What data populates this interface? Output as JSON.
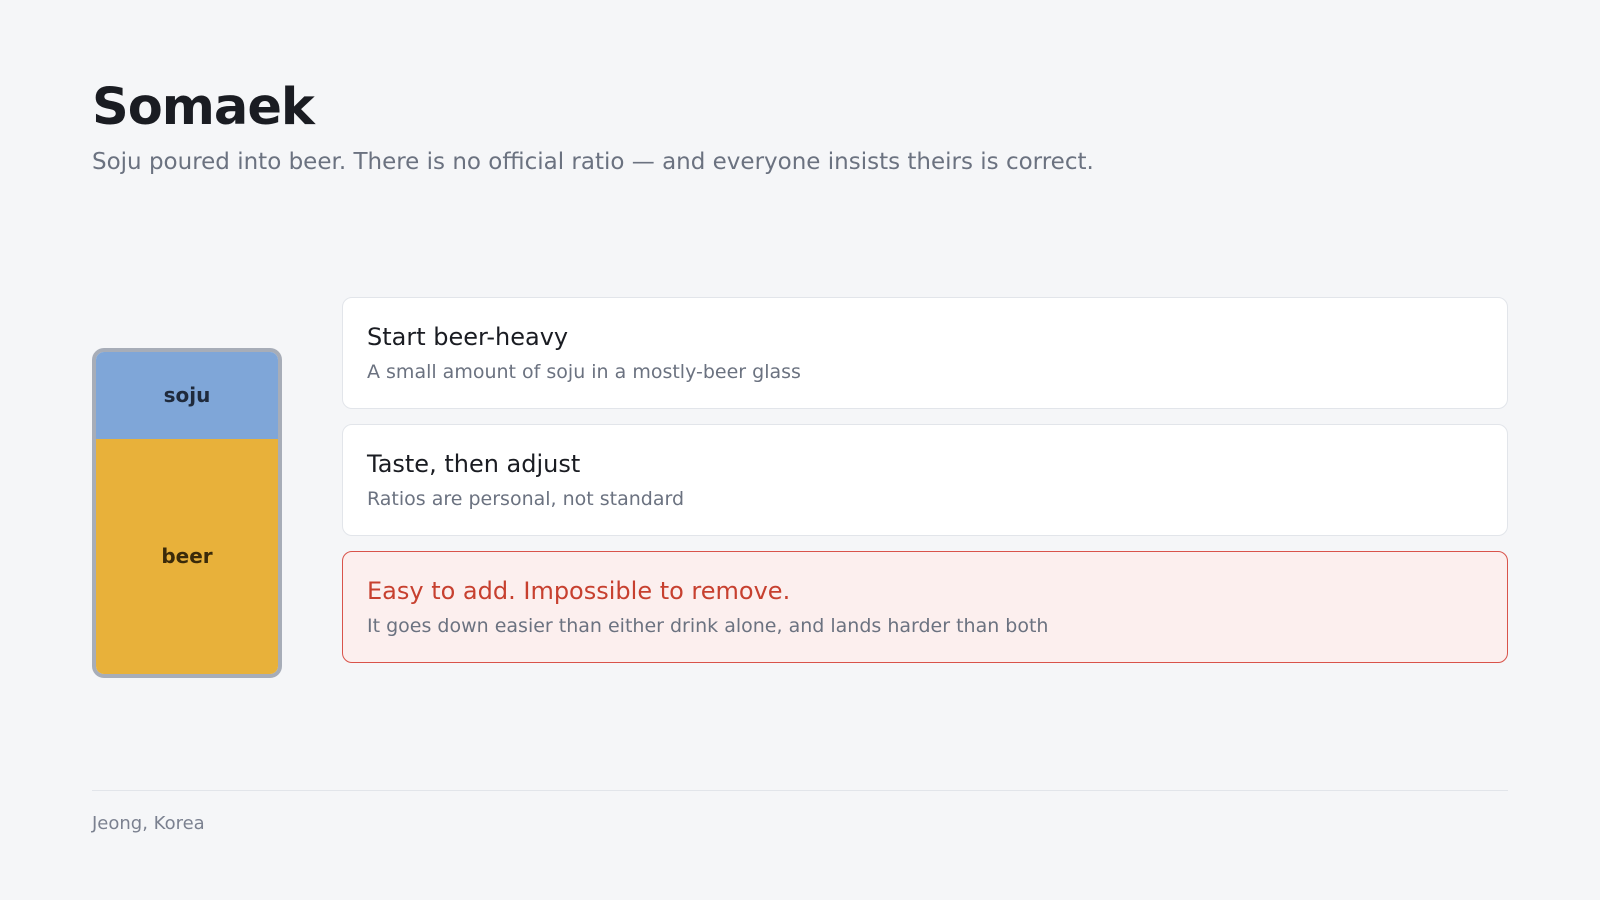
{
  "header": {
    "title": "Somaek",
    "subtitle": "Soju poured into beer. There is no official ratio — and everyone insists theirs is correct."
  },
  "glass": {
    "soju": {
      "label": "soju",
      "fraction": 0.27,
      "color": "#7fa6d8"
    },
    "beer": {
      "label": "beer",
      "fraction": 0.73,
      "color": "#e8b13a"
    }
  },
  "cards": [
    {
      "title": "Start beer-heavy",
      "description": "A small amount of soju in a mostly-beer glass",
      "variant": "default"
    },
    {
      "title": "Taste, then adjust",
      "description": "Ratios are personal, not standard",
      "variant": "default"
    },
    {
      "title": "Easy to add. Impossible to remove.",
      "description": "It goes down easier than either drink alone, and lands harder than both",
      "variant": "warning"
    }
  ],
  "footer": {
    "text": "Jeong, Korea"
  }
}
